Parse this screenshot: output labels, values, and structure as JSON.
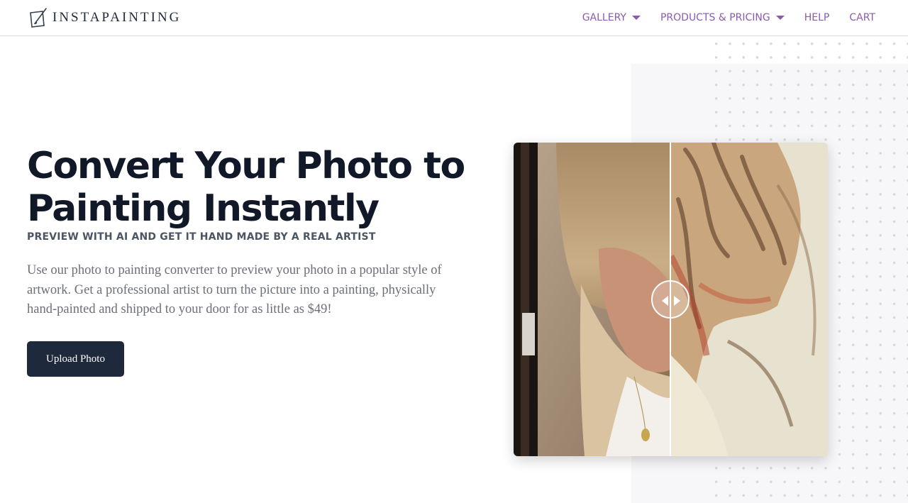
{
  "brand": {
    "name": "INSTAPAINTING",
    "logo_icon": "brush-canvas-icon"
  },
  "nav": {
    "items": [
      {
        "label": "GALLERY",
        "has_dropdown": true
      },
      {
        "label": "PRODUCTS & PRICING",
        "has_dropdown": true
      },
      {
        "label": "HELP",
        "has_dropdown": false
      },
      {
        "label": "CART",
        "has_dropdown": false
      }
    ],
    "color": "#8a5ab0"
  },
  "hero": {
    "title": "Convert Your Photo to Painting Instantly",
    "subtitle": "PREVIEW WITH AI AND GET IT HAND MADE BY A REAL ARTIST",
    "description": "Use our photo to painting converter to preview your photo in a popular style of artwork. Get a professional artist to turn the picture into a painting, physically hand-painted and shipped to your door for as little as $49!",
    "cta_label": "Upload Photo",
    "cta_color": "#1e293b"
  },
  "comparison": {
    "left": "photo",
    "right": "painting",
    "handle_icon": "left-right-arrows-icon"
  }
}
